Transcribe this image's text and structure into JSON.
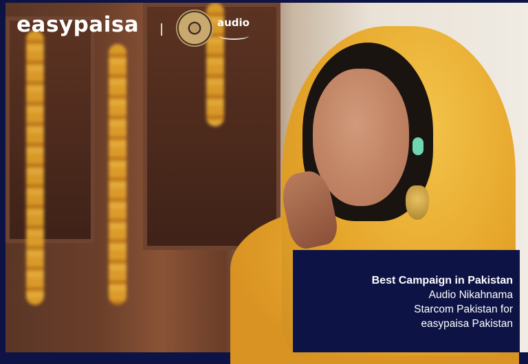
{
  "logos": {
    "brand": "easypaisa",
    "partner": "audio"
  },
  "caption": {
    "award": "Best Campaign in Pakistan",
    "campaign": "Audio Nikahnama",
    "agency": "Starcom Pakistan for",
    "client": "easypaisa Pakistan"
  },
  "colors": {
    "panel": "#0d1445",
    "dupatta": "#e5a52a",
    "earphone": "#6fd5b2"
  }
}
